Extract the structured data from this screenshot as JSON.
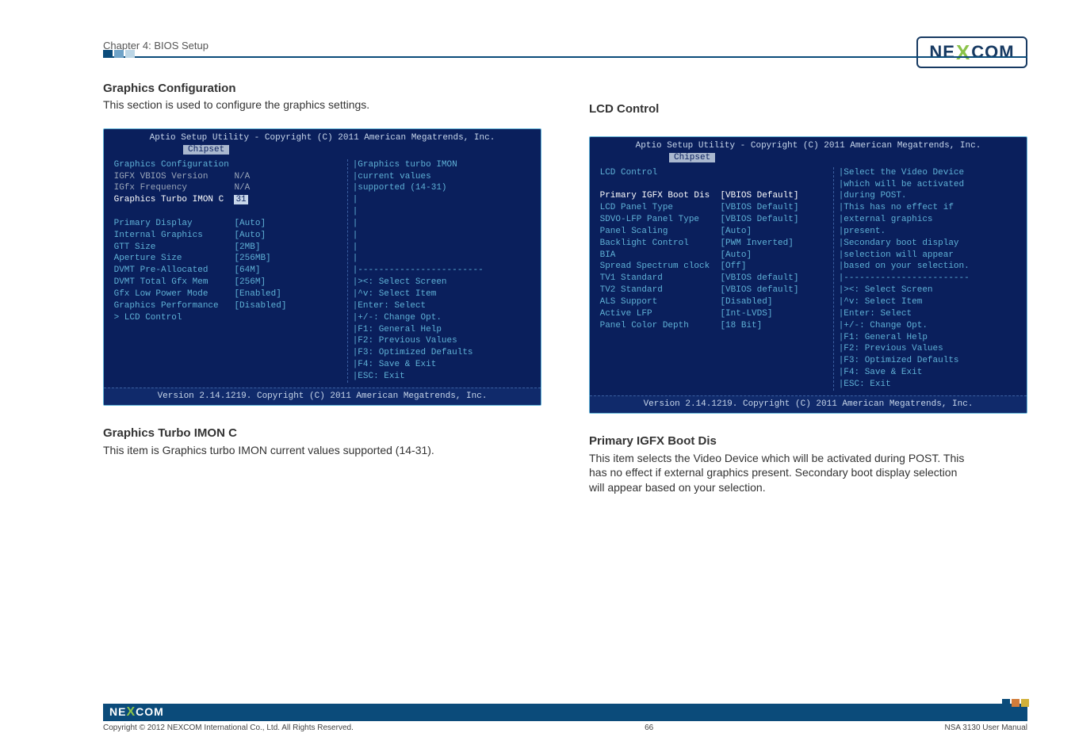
{
  "chapter": "Chapter 4: BIOS Setup",
  "logo_text": {
    "pre": "NE",
    "x": "X",
    "post": "COM"
  },
  "left": {
    "title": "Graphics Configuration",
    "desc": "This section is used to configure the graphics settings.",
    "bios": {
      "top": "Aptio Setup Utility - Copyright (C) 2011 American Megatrends, Inc.",
      "tab": "Chipset",
      "bottom": "Version 2.14.1219. Copyright (C) 2011 American Megatrends, Inc.",
      "rows": [
        {
          "label": "Graphics Configuration",
          "value": "",
          "cls": "bi-cyan"
        },
        {
          "label": "IGFX VBIOS Version",
          "value": "N/A",
          "cls": "bi-grey"
        },
        {
          "label": "IGfx Frequency",
          "value": "N/A",
          "cls": "bi-grey"
        },
        {
          "label": "Graphics Turbo IMON C",
          "value": "31",
          "cls": "bi-white",
          "sel": true
        },
        {
          "label": "",
          "value": "",
          "cls": ""
        },
        {
          "label": "Primary Display",
          "value": "[Auto]",
          "cls": "bi-cyan"
        },
        {
          "label": "Internal Graphics",
          "value": "[Auto]",
          "cls": "bi-cyan"
        },
        {
          "label": "GTT Size",
          "value": "[2MB]",
          "cls": "bi-cyan"
        },
        {
          "label": "Aperture Size",
          "value": "[256MB]",
          "cls": "bi-cyan"
        },
        {
          "label": "DVMT Pre-Allocated",
          "value": "[64M]",
          "cls": "bi-cyan"
        },
        {
          "label": "DVMT Total Gfx Mem",
          "value": "[256M]",
          "cls": "bi-cyan"
        },
        {
          "label": "Gfx Low Power Mode",
          "value": "[Enabled]",
          "cls": "bi-cyan"
        },
        {
          "label": "Graphics Performance",
          "value": "[Disabled]",
          "cls": "bi-cyan"
        },
        {
          "label": "> LCD Control",
          "value": "",
          "cls": "bi-cyan"
        }
      ],
      "help": [
        "Graphics turbo IMON",
        "current values",
        "supported (14-31)",
        "",
        "",
        "",
        "",
        "",
        "",
        "------------------------",
        "><: Select Screen",
        "^v: Select Item",
        "Enter: Select",
        "+/-: Change Opt.",
        "F1: General Help",
        "F2: Previous Values",
        "F3: Optimized Defaults",
        "F4: Save & Exit",
        "ESC: Exit"
      ]
    },
    "para_title": "Graphics Turbo IMON C",
    "para_body": "This item is Graphics turbo IMON current values supported (14-31)."
  },
  "right": {
    "title": "LCD Control",
    "bios": {
      "top": "Aptio Setup Utility - Copyright (C) 2011 American Megatrends, Inc.",
      "tab": "Chipset",
      "bottom": "Version 2.14.1219. Copyright (C) 2011 American Megatrends, Inc.",
      "rows": [
        {
          "label": "LCD Control",
          "value": "",
          "cls": "bi-cyan"
        },
        {
          "label": "",
          "value": "",
          "cls": ""
        },
        {
          "label": "Primary IGFX Boot Dis",
          "value": "[VBIOS Default]",
          "cls": "bi-white",
          "sel": false,
          "hl": true
        },
        {
          "label": "LCD Panel Type",
          "value": "[VBIOS Default]",
          "cls": "bi-cyan"
        },
        {
          "label": "SDVO-LFP Panel Type",
          "value": "[VBIOS Default]",
          "cls": "bi-cyan"
        },
        {
          "label": "Panel Scaling",
          "value": "[Auto]",
          "cls": "bi-cyan"
        },
        {
          "label": "Backlight Control",
          "value": "[PWM Inverted]",
          "cls": "bi-cyan"
        },
        {
          "label": "BIA",
          "value": "[Auto]",
          "cls": "bi-cyan"
        },
        {
          "label": "Spread Spectrum clock",
          "value": "[Off]",
          "cls": "bi-cyan"
        },
        {
          "label": "TV1 Standard",
          "value": "[VBIOS default]",
          "cls": "bi-cyan"
        },
        {
          "label": "TV2 Standard",
          "value": "[VBIOS default]",
          "cls": "bi-cyan"
        },
        {
          "label": "ALS Support",
          "value": "[Disabled]",
          "cls": "bi-cyan"
        },
        {
          "label": "Active LFP",
          "value": "[Int-LVDS]",
          "cls": "bi-cyan"
        },
        {
          "label": "Panel Color Depth",
          "value": "[18 Bit]",
          "cls": "bi-cyan"
        }
      ],
      "help": [
        "Select the Video Device",
        "which will be activated",
        "during POST.",
        "This has no effect if",
        "external graphics",
        "present.",
        "Secondary boot display",
        "selection will appear",
        "based on your selection.",
        "------------------------",
        "><: Select Screen",
        "^v: Select Item",
        "Enter: Select",
        "+/-: Change Opt.",
        "F1: General Help",
        "F2: Previous Values",
        "F3: Optimized Defaults",
        "F4: Save & Exit",
        "ESC: Exit"
      ]
    },
    "para_title": "Primary IGFX Boot Dis",
    "para_body": "This item selects the Video Device which will be activated during POST. This has no effect if external graphics present. Secondary boot display selection will appear based on your selection."
  },
  "footer": {
    "copyright": "Copyright © 2012 NEXCOM International Co., Ltd. All Rights Reserved.",
    "page": "66",
    "doc": "NSA 3130 User Manual"
  },
  "colors": {
    "blocks": [
      "#0b4b7a",
      "#6fa3c8",
      "#bcd6e6"
    ],
    "corner": [
      "#0b4b7a",
      "#d17c3a",
      "#d1b13a"
    ]
  }
}
